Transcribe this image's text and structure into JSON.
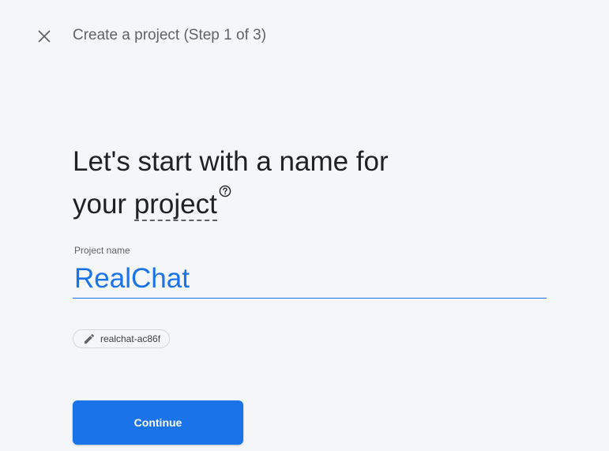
{
  "header": {
    "close_icon": "close-icon",
    "title": "Create a project (Step 1 of 3)"
  },
  "main": {
    "heading_line1": "Let's start with a name for",
    "heading_line2_prefix": "your ",
    "heading_term": "project",
    "help_icon": "help-circle-icon",
    "field_label": "Project name",
    "project_name_value": "RealChat",
    "project_id": "realchat-ac86f",
    "edit_icon": "pencil-icon",
    "continue_label": "Continue"
  },
  "colors": {
    "accent": "#1a73e8",
    "background": "#f4f6f8",
    "text_primary": "#202124",
    "text_secondary": "#5f6368"
  }
}
